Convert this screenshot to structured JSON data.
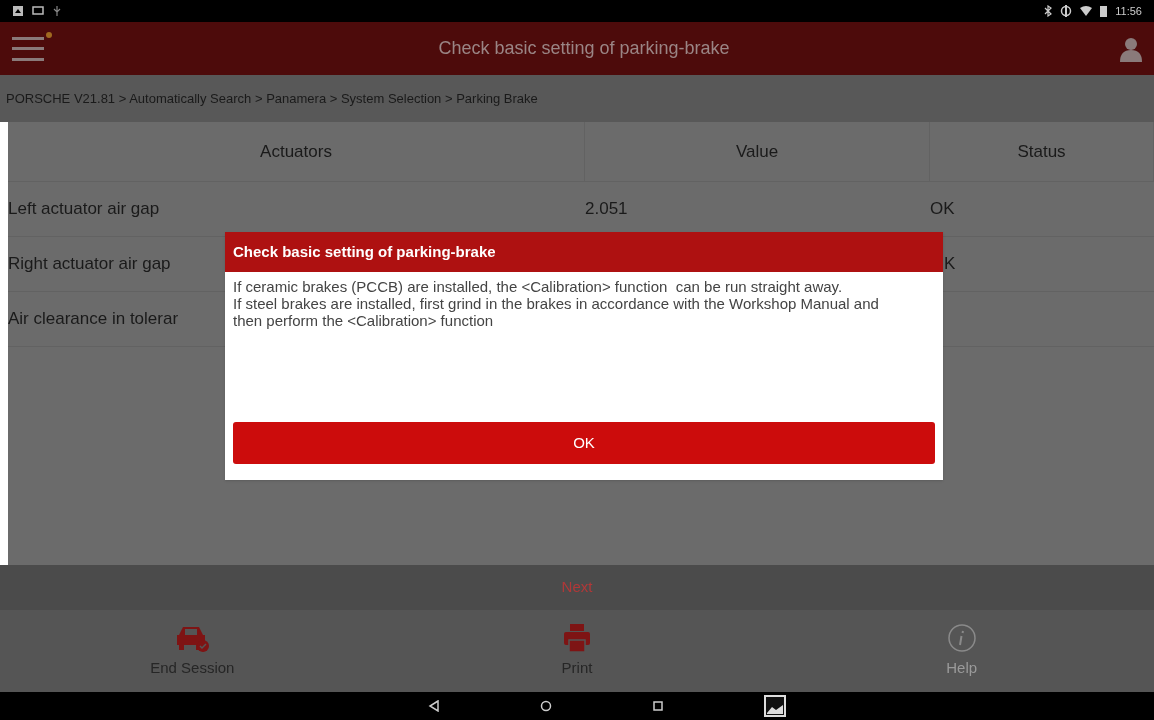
{
  "status_bar": {
    "time": "11:56"
  },
  "title_bar": {
    "title": "Check basic setting of parking-brake"
  },
  "breadcrumb": "PORSCHE V21.81 > Automatically Search > Panamera > System Selection > Parking Brake",
  "table": {
    "columns": [
      "Actuators",
      "Value",
      "Status"
    ],
    "rows": [
      {
        "cells": [
          "Left actuator air gap",
          "2.051",
          "OK"
        ]
      },
      {
        "cells": [
          "Right actuator air gap",
          "",
          "K"
        ]
      },
      {
        "cells": [
          "Air clearance in tolerar",
          "",
          ""
        ]
      }
    ]
  },
  "dialog": {
    "title": "Check basic setting of parking-brake",
    "lines": [
      "If ceramic brakes (PCCB) are installed, the <Calibration> function  can be run straight away.",
      "If steel brakes are installed, first grind in the brakes in accordance with the Workshop Manual and then perform the <Calibration> function"
    ],
    "button": "OK"
  },
  "next_button": "Next",
  "toolbar": [
    {
      "kind": "car",
      "label": "End Session",
      "disabled": false
    },
    {
      "kind": "printer",
      "label": "Print",
      "disabled": false
    },
    {
      "kind": "info",
      "label": "Help",
      "disabled": true
    }
  ]
}
